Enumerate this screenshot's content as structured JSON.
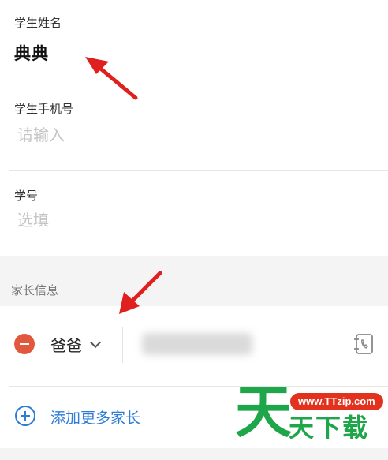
{
  "student": {
    "name_label": "学生姓名",
    "name_value": "典典",
    "phone_label": "学生手机号",
    "phone_placeholder": "请输入",
    "id_label": "学号",
    "id_placeholder": "选填"
  },
  "parents": {
    "section_title": "家长信息",
    "entries": [
      {
        "relation": "爸爸"
      }
    ],
    "add_label": "添加更多家长"
  },
  "colors": {
    "accent_blue": "#2e7cd6",
    "remove_red": "#e2583e",
    "annotation_red": "#e0201e",
    "watermark_green": "#20a64a"
  },
  "watermark": {
    "big_char": "天",
    "url": "www.TTzip.com",
    "text": "天下载"
  },
  "icons": [
    "minus-circle-icon",
    "chevron-down-icon",
    "contacts-book-icon",
    "plus-circle-icon",
    "red-arrow-icon"
  ]
}
